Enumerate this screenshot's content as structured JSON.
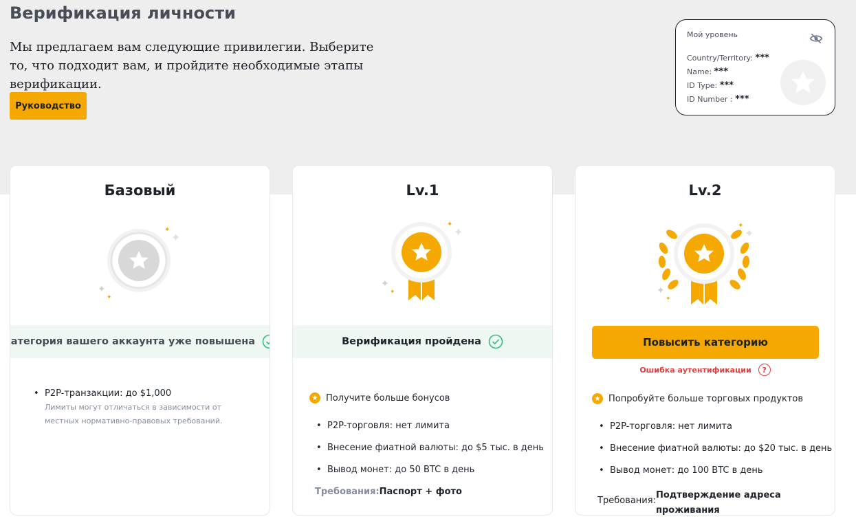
{
  "header": {
    "title": "Верификация личности",
    "subtitle": "Мы предлагаем вам следующие привилегии. Выберите то, что подходит вам, и пройдите необходимые этапы верификации.",
    "guide_button": "Руководство"
  },
  "my_level": {
    "title": "Мой уровень",
    "rows": [
      {
        "label": "Country/Territory:",
        "value": "***"
      },
      {
        "label": "Name:",
        "value": "***"
      },
      {
        "label": "ID Type:",
        "value": "***"
      },
      {
        "label": "ID Number :",
        "value": "***"
      }
    ],
    "icon": "eye-off-icon"
  },
  "cards": {
    "basic": {
      "title": "Базовый",
      "status": "Категория вашего аккаунта уже повышена",
      "bullet": "P2P-транзакции: до $1,000",
      "note": "Лимиты могут отличаться в зависимости от местных нормативно-правовых требований."
    },
    "lv1": {
      "title": "Lv.1",
      "status": "Верификация пройдена",
      "perk": "Получите больше бонусов",
      "bullets": [
        "P2P-торговля: нет лимита",
        "Внесение фиатной валюты: до $5 тыс. в день",
        "Вывод монет: до 50 BTC в день"
      ],
      "req_label": "Требования:",
      "req_value": "Паспорт + фото"
    },
    "lv2": {
      "title": "Lv.2",
      "button": "Повысить категорию",
      "error": "Ошибка аутентификации",
      "error_help": "?",
      "perk": "Попробуйте больше торговых продуктов",
      "bullets": [
        "P2P-торговля: нет лимита",
        "Внесение фиатной валюты: до $20 тыс. в день",
        "Вывод монет: до 100 BTC в день"
      ],
      "req_label": "Требования:",
      "req_value_line1": "Подтверждение адреса",
      "req_value_line2": "проживания"
    }
  },
  "colors": {
    "accent": "#f5a800",
    "success": "#2ebd85",
    "error": "#e03c3c",
    "band": "#eeeeee"
  }
}
